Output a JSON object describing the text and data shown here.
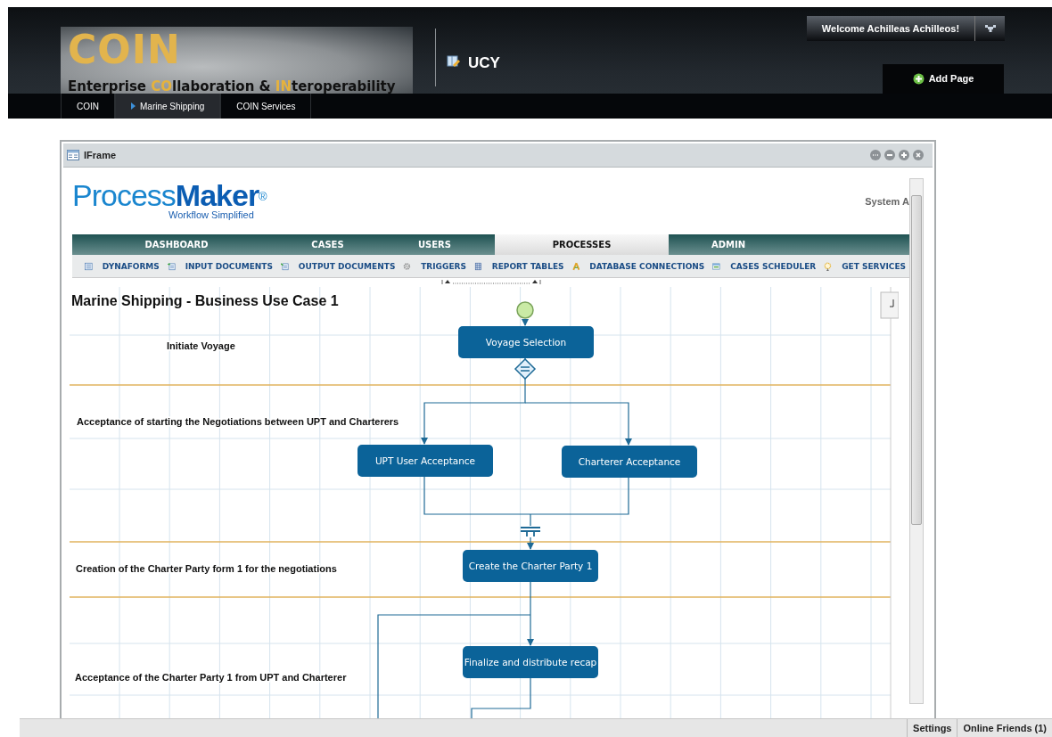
{
  "header": {
    "logo": {
      "title": "COIN",
      "subtitle": [
        {
          "text": "Enterprise ",
          "highlight": false
        },
        {
          "text": "CO",
          "highlight": true
        },
        {
          "text": "llaboration & ",
          "highlight": false
        },
        {
          "text": "IN",
          "highlight": true
        },
        {
          "text": "teroperability",
          "highlight": false
        }
      ]
    },
    "community": "UCY",
    "welcome": "Welcome Achilleas Achilleos!",
    "add_page": "Add Page",
    "nav": [
      {
        "label": "COIN",
        "selected": false
      },
      {
        "label": "Marine Shipping",
        "selected": true
      },
      {
        "label": "COIN Services",
        "selected": false
      }
    ]
  },
  "portlet": {
    "title": "IFrame",
    "app": {
      "logo": {
        "light": "Process",
        "bold": "Maker",
        "mark": "®",
        "tagline": "Workflow Simplified"
      },
      "user": "System A",
      "tabs": [
        {
          "label": "DASHBOARD",
          "selected": false
        },
        {
          "label": "CASES",
          "selected": false
        },
        {
          "label": "USERS",
          "selected": false
        },
        {
          "label": "PROCESSES",
          "selected": true
        },
        {
          "label": "ADMIN",
          "selected": false
        }
      ],
      "toolbar": [
        "DYNAFORMS",
        "INPUT DOCUMENTS",
        "OUTPUT DOCUMENTS",
        "TRIGGERS",
        "REPORT TABLES",
        "DATABASE CONNECTIONS",
        "CASES SCHEDULER",
        "GET SERVICES"
      ],
      "diagram": {
        "title": "Marine Shipping - Business Use Case 1",
        "lanes": [
          "Initiate Voyage",
          "Acceptance of starting the Negotiations between UPT and Charterers",
          "Creation of the Charter Party form 1 for the negotiations",
          "Acceptance of the Charter Party 1 from UPT and Charterer"
        ],
        "nodes": [
          {
            "kind": "start"
          },
          {
            "kind": "task",
            "label": "Voyage Selection"
          },
          {
            "kind": "gateway"
          },
          {
            "kind": "task",
            "label": "UPT User Acceptance"
          },
          {
            "kind": "task",
            "label": "Charterer Acceptance"
          },
          {
            "kind": "join"
          },
          {
            "kind": "task",
            "label": "Create the Charter Party 1"
          },
          {
            "kind": "task",
            "label": "Finalize and distribute recap"
          }
        ]
      }
    }
  },
  "footer": {
    "buttons": [
      "Settings",
      "Online Friends (1)"
    ]
  }
}
